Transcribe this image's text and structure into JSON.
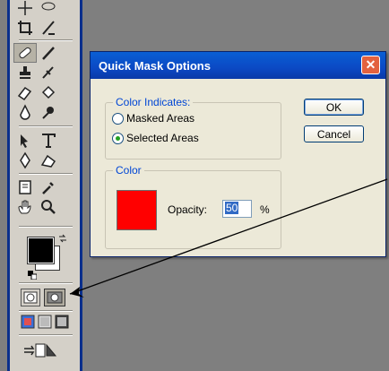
{
  "dialog": {
    "title": "Quick Mask Options",
    "color_indicates": {
      "legend": "Color Indicates:",
      "options": [
        "Masked Areas",
        "Selected Areas"
      ],
      "selected": "Selected Areas"
    },
    "color_group": {
      "legend": "Color",
      "swatch_color": "#ff0000",
      "opacity_label": "Opacity:",
      "opacity_value": "50",
      "opacity_unit": "%"
    },
    "buttons": {
      "ok": "OK",
      "cancel": "Cancel"
    }
  },
  "toolbox": {
    "tools": [
      "crop-icon",
      "slice-icon",
      "healing-brush-icon",
      "brush-icon",
      "clone-stamp-icon",
      "history-brush-icon",
      "eraser-icon",
      "paint-bucket-icon",
      "blur-icon",
      "burn-icon",
      "path-select-icon",
      "type-icon",
      "pen-icon",
      "shape-icon",
      "notes-icon",
      "eyedropper-icon",
      "hand-icon",
      "zoom-icon"
    ],
    "foreground_color": "#000000",
    "background_color": "#ffffff"
  }
}
